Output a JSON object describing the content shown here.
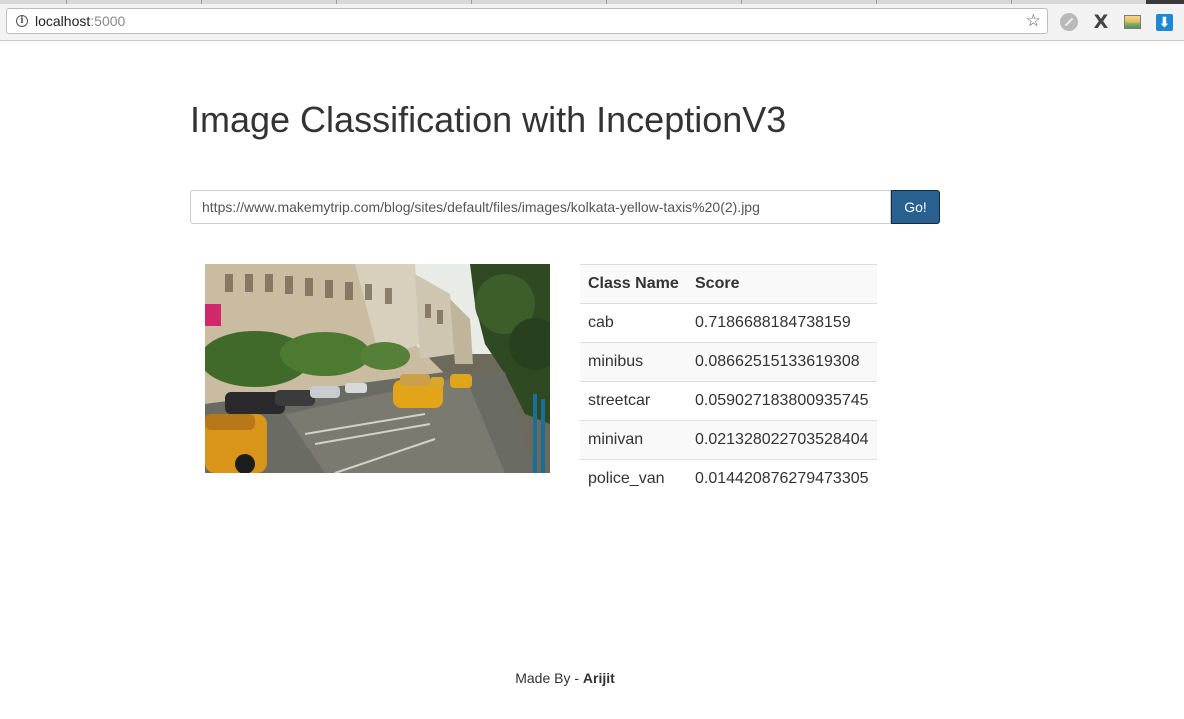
{
  "browser": {
    "url_host": "localhost",
    "url_port": ":5000",
    "info_icon": "info-icon",
    "star_icon": "star-icon",
    "extensions": [
      "compass-icon",
      "x-icon",
      "image-icon",
      "download-icon"
    ]
  },
  "page": {
    "title": "Image Classification with InceptionV3"
  },
  "form": {
    "url_value": "https://www.makemytrip.com/blog/sites/default/files/images/kolkata-yellow-taxis%20(2).jpg",
    "go_label": "Go!"
  },
  "results": {
    "headers": [
      "Class Name",
      "Score"
    ],
    "rows": [
      {
        "class_name": "cab",
        "score": "0.7186688184738159"
      },
      {
        "class_name": "minibus",
        "score": "0.08662515133619308"
      },
      {
        "class_name": "streetcar",
        "score": "0.059027183800935745"
      },
      {
        "class_name": "minivan",
        "score": "0.021328022703528404"
      },
      {
        "class_name": "police_van",
        "score": "0.014420876279473305"
      }
    ]
  },
  "footer": {
    "prefix": "Made By - ",
    "author": "Arijit"
  },
  "colors": {
    "primary_button": "#286090",
    "table_stripe": "#f9f9f9",
    "text": "#333333"
  }
}
